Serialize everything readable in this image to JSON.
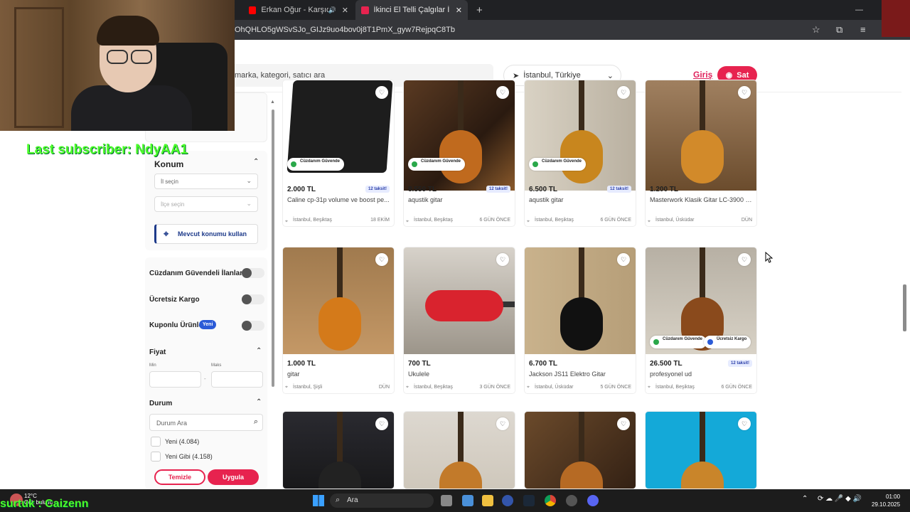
{
  "browser": {
    "tabs": [
      {
        "title": "Erkan Oğur - Karşıda Görün",
        "favicon_color": "#ff0000"
      },
      {
        "title": "İkinci El Telli Çalgılar İlanları ve",
        "favicon_color": "#e7234f"
      }
    ],
    "url": "OhQHLO5gWSvSJo_GIJz9uo4bov0j8T1PmX_gyw7RejpqC8Tb"
  },
  "overlay": {
    "last_subscriber": "Last subscriber: NdyAA1",
    "bottom_text": "surtuk : Caizenn"
  },
  "header": {
    "search_placeholder": "marka, kategori, satıcı ara",
    "location": "İstanbul, Türkiye",
    "login_label": "Giriş",
    "sell_label": "Sat"
  },
  "sidebar": {
    "konum_title": "Konum",
    "il_placeholder": "İl seçin",
    "ilce_placeholder": "İlçe seçin",
    "current_location_label": "Mevcut konumu kullan",
    "toggles": [
      {
        "label": "Cüzdanım Güvendeli İlanlar",
        "on": false
      },
      {
        "label": "Ücretsiz Kargo",
        "on": false
      },
      {
        "label": "Kuponlu Ürünler",
        "badge": "Yeni",
        "on": false
      }
    ],
    "fiyat_title": "Fiyat",
    "min_label": "Min",
    "max_label": "Maks",
    "durum_title": "Durum",
    "durum_search_placeholder": "Durum Ara",
    "durum_options": [
      "Yeni (4.084)",
      "Yeni Gibi (4.158)"
    ],
    "clear_label": "Temizle",
    "apply_label": "Uygula"
  },
  "listings": [
    {
      "price": "2.000 TL",
      "title": "Caline cp-31p volume ve boost pe...",
      "location": "İstanbul, Beşiktaş",
      "date": "18 EKİM",
      "taksit": "12 taksit!",
      "badges": [
        "Cüzdanım Güvende"
      ],
      "img": "pedal"
    },
    {
      "price": "8.550 TL",
      "title": "aqustik gitar",
      "location": "İstanbul, Beşiktaş",
      "date": "6 GÜN ÖNCE",
      "taksit": "12 taksit!",
      "badges": [
        "Cüzdanım Güvende"
      ],
      "img": "shop"
    },
    {
      "price": "6.500 TL",
      "title": "aqustik gitar",
      "location": "İstanbul, Beşiktaş",
      "date": "6 GÜN ÖNCE",
      "taksit": "12 taksit!",
      "badges": [
        "Cüzdanım Güvende"
      ],
      "img": "acoustic"
    },
    {
      "price": "1.200 TL",
      "title": "Masterwork Klasik Gitar LC-3900 O...",
      "location": "İstanbul, Üsküdar",
      "date": "DÜN",
      "taksit": "",
      "badges": [],
      "img": "classic"
    },
    {
      "price": "1.000 TL",
      "title": "gitar",
      "location": "İstanbul, Şişli",
      "date": "DÜN",
      "taksit": "",
      "badges": [],
      "img": "sunburst"
    },
    {
      "price": "700 TL",
      "title": "Ukulele",
      "location": "İstanbul, Beşiktaş",
      "date": "3 GÜN ÖNCE",
      "taksit": "",
      "badges": [],
      "img": "ukulele"
    },
    {
      "price": "6.700 TL",
      "title": "Jackson JS11 Elektro Gitar",
      "location": "İstanbul, Üsküdar",
      "date": "5 GÜN ÖNCE",
      "taksit": "",
      "badges": [],
      "img": "electric"
    },
    {
      "price": "26.500 TL",
      "title": "profesyonel ud",
      "location": "İstanbul, Beşiktaş",
      "date": "6 GÜN ÖNCE",
      "taksit": "12 taksit!",
      "badges": [
        "Cüzdanım Güvende",
        "Ücretsiz Kargo"
      ],
      "img": "oud"
    },
    {
      "price": "",
      "title": "",
      "location": "",
      "date": "",
      "taksit": "",
      "badges": [],
      "img": "dark"
    },
    {
      "price": "",
      "title": "",
      "location": "",
      "date": "",
      "taksit": "",
      "badges": [],
      "img": "classics"
    },
    {
      "price": "",
      "title": "",
      "location": "",
      "date": "",
      "taksit": "",
      "badges": [],
      "img": "shop2"
    },
    {
      "price": "",
      "title": "",
      "location": "",
      "date": "",
      "taksit": "",
      "badges": [],
      "img": "blue"
    }
  ],
  "taskbar": {
    "weather": "12°C",
    "weather_desc": "Çok bulutlu",
    "search_label": "Ara",
    "time": "01:00",
    "date": "29.10.2025"
  },
  "colors": {
    "accent": "#e7234f",
    "green_overlay": "#4cff2a"
  }
}
